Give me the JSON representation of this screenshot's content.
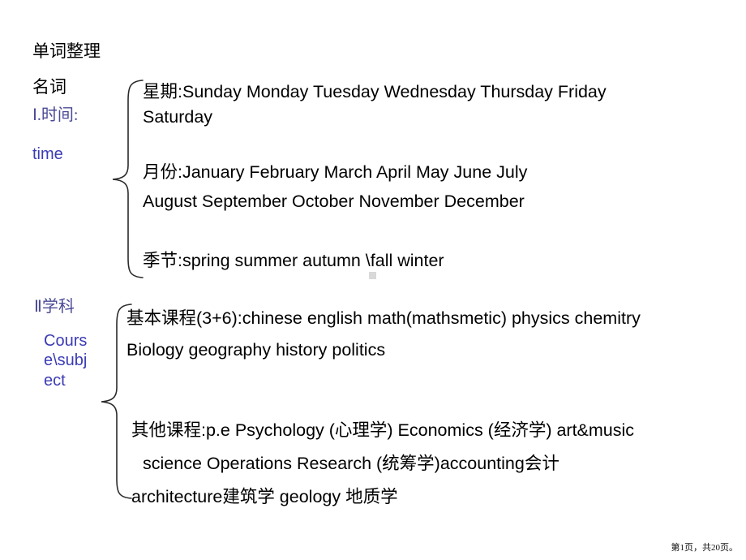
{
  "slide": {
    "title_heading": "单词整理",
    "noun_heading": "名词",
    "sections": [
      {
        "id": "time",
        "marker": "Ⅰ.时间:",
        "english_label": "time",
        "groups": [
          {
            "name": "weekdays",
            "prefix_cn": "星期:",
            "line1": "星期:Sunday   Monday   Tuesday   Wednesday   Thursday   Friday",
            "line2": "Saturday",
            "items": [
              "Sunday",
              "Monday",
              "Tuesday",
              "Wednesday",
              "Thursday",
              "Friday",
              "Saturday"
            ]
          },
          {
            "name": "months",
            "prefix_cn": "月份:",
            "line1": "月份:January     February     March      April   May June   July",
            "line2": "August     September    October    November     December",
            "items": [
              "January",
              "February",
              "March",
              "April",
              "May",
              "June",
              "July",
              "August",
              "September",
              "October",
              "November",
              "December"
            ]
          },
          {
            "name": "seasons",
            "prefix_cn": "季节:",
            "line1": "季节:spring    summer      autumn \\fall      winter",
            "line2": "",
            "items": [
              "spring",
              "summer",
              "autumn \\fall",
              "winter"
            ]
          }
        ]
      },
      {
        "id": "subject",
        "marker": "Ⅱ学科",
        "english_label": "Course\\subject",
        "groups": [
          {
            "name": "basic-courses",
            "prefix_cn": "基本课程(3+6):",
            "line1": "基本课程(3+6):chinese  english math(mathsmetic) physics chemitry",
            "line2": "Biology  geography history  politics",
            "line3": "",
            "items": [
              "chinese",
              "english",
              "math(mathsmetic)",
              "physics",
              "chemitry",
              "Biology",
              "geography",
              "history",
              "politics"
            ]
          },
          {
            "name": "other-courses",
            "prefix_cn": "其他课程:",
            "line1": "其他课程:p.e Psychology (心理学) Economics (经济学) art&music",
            "line2": "science   Operations Research (统筹学)accounting会计",
            "line3": "architecture建筑学 geology 地质学",
            "items": [
              "p.e",
              "Psychology (心理学)",
              "Economics (经济学)",
              "art&music",
              "science",
              "Operations Research (统筹学)",
              "accounting会计",
              "architecture建筑学",
              "geology 地质学"
            ]
          }
        ]
      }
    ]
  },
  "footer": {
    "page_indicator": "第1页，共20页。"
  },
  "colors": {
    "text": "#000000",
    "marker_blue": "#4a4a96",
    "english_blue": "#3b3bb5",
    "cn_gray": "#3a3a3a",
    "marker_square": "#d9d9d9",
    "background": "#ffffff"
  }
}
